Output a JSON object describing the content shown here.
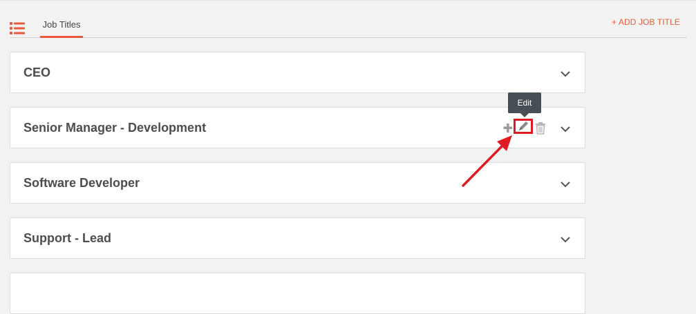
{
  "tabs": {
    "job_titles_label": "Job Titles"
  },
  "header": {
    "add_button_label": "+ ADD JOB TITLE"
  },
  "job_titles": [
    {
      "label": "CEO"
    },
    {
      "label": "Senior Manager - Development"
    },
    {
      "label": "Software Developer"
    },
    {
      "label": "Support - Lead"
    },
    {
      "label": ""
    }
  ],
  "tooltip": {
    "text": "Edit"
  },
  "icons": {
    "list": "list-icon",
    "add": "plus-icon",
    "edit": "pencil-icon",
    "delete": "trash-icon",
    "expand": "chevron-down-icon"
  },
  "colors": {
    "accent": "#e8583a",
    "annotation_red": "#e01a22",
    "tooltip_bg": "#474e54",
    "page_bg": "#f2f2f2"
  }
}
